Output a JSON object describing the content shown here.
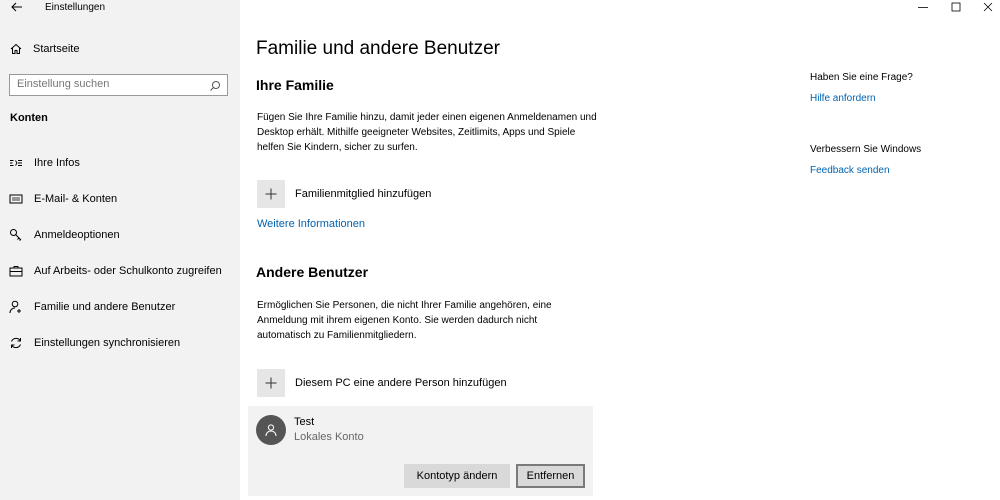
{
  "window": {
    "title": "Einstellungen"
  },
  "sidebar": {
    "home_label": "Startseite",
    "search_placeholder": "Einstellung suchen",
    "section_label": "Konten",
    "items": [
      {
        "label": "Ihre Infos",
        "icon": "person-card-icon"
      },
      {
        "label": "E-Mail- & Konten",
        "icon": "mail-icon"
      },
      {
        "label": "Anmeldeoptionen",
        "icon": "key-icon"
      },
      {
        "label": "Auf Arbeits- oder Schulkonto zugreifen",
        "icon": "briefcase-icon"
      },
      {
        "label": "Familie und andere Benutzer",
        "icon": "person-add-icon"
      },
      {
        "label": "Einstellungen synchronisieren",
        "icon": "sync-icon"
      }
    ]
  },
  "main": {
    "title": "Familie und andere Benutzer",
    "family": {
      "heading": "Ihre Familie",
      "description": "Fügen Sie Ihre Familie hinzu, damit jeder einen eigenen Anmeldenamen und Desktop erhält. Mithilfe geeigneter Websites, Zeitlimits, Apps und Spiele helfen Sie Kindern, sicher zu surfen.",
      "add_label": "Familienmitglied hinzufügen",
      "more_info": "Weitere Informationen"
    },
    "others": {
      "heading": "Andere Benutzer",
      "description": "Ermöglichen Sie Personen, die nicht Ihrer Familie angehören, eine Anmeldung mit ihrem eigenen Konto. Sie werden dadurch nicht automatisch zu Familienmitgliedern.",
      "add_label": "Diesem PC eine andere Person hinzufügen",
      "user": {
        "name": "Test",
        "type": "Lokales Konto",
        "change_button": "Kontotyp ändern",
        "remove_button": "Entfernen"
      }
    }
  },
  "aside": {
    "question": "Haben Sie eine Frage?",
    "help_link": "Hilfe anfordern",
    "improve": "Verbessern Sie Windows",
    "feedback_link": "Feedback senden"
  },
  "colors": {
    "accent": "#0063b1",
    "sidebar_bg": "#f2f2f2",
    "card_bg": "#f2f2f2"
  }
}
